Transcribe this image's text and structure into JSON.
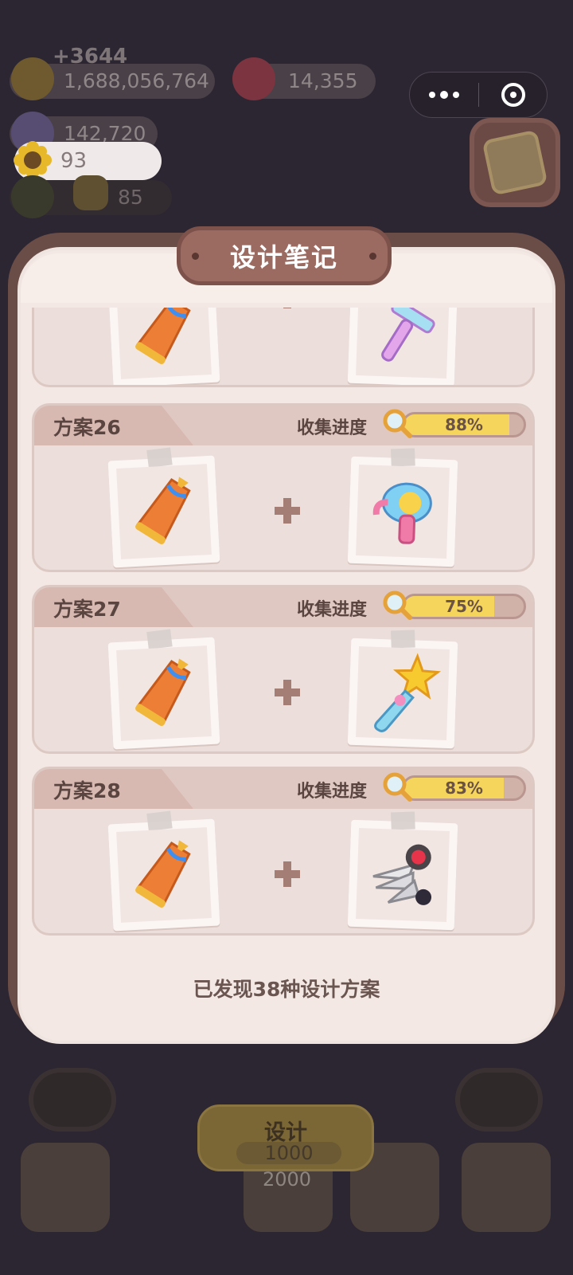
{
  "background": {
    "float_text": "+3644",
    "resources": [
      {
        "name": "cookie",
        "value": "1,688,056,764",
        "color": "#7a6632"
      },
      {
        "name": "strawberry",
        "value": "14,355",
        "color": "#8a3a42"
      },
      {
        "name": "gem",
        "value": "142,720",
        "color": "#5c5278"
      }
    ],
    "flower_count": "93",
    "pet_count": "85",
    "design_button": {
      "label": "设计",
      "cost": "1000"
    },
    "price_2000": "2000"
  },
  "capsule": {
    "more_icon": "more-dots-icon",
    "close_icon": "target-circle-icon"
  },
  "modal": {
    "title": "设计笔记",
    "schemes": [
      {
        "name": "",
        "progress_label": "",
        "progress": null,
        "left_item": "lantern-wand",
        "right_item": "razor"
      },
      {
        "name": "方案26",
        "progress_label": "收集进度",
        "progress": 88,
        "progress_text": "88%",
        "left_item": "lantern-wand",
        "right_item": "bubble-gun"
      },
      {
        "name": "方案27",
        "progress_label": "收集进度",
        "progress": 75,
        "progress_text": "75%",
        "left_item": "lantern-wand",
        "right_item": "star-wand"
      },
      {
        "name": "方案28",
        "progress_label": "收集进度",
        "progress": 83,
        "progress_text": "83%",
        "left_item": "lantern-wand",
        "right_item": "scissors-fan"
      }
    ],
    "footer": "已发现38种设计方案"
  },
  "colors": {
    "accent": "#f5d55c",
    "panel": "#f3e8e3",
    "frame": "#6b4d47"
  }
}
